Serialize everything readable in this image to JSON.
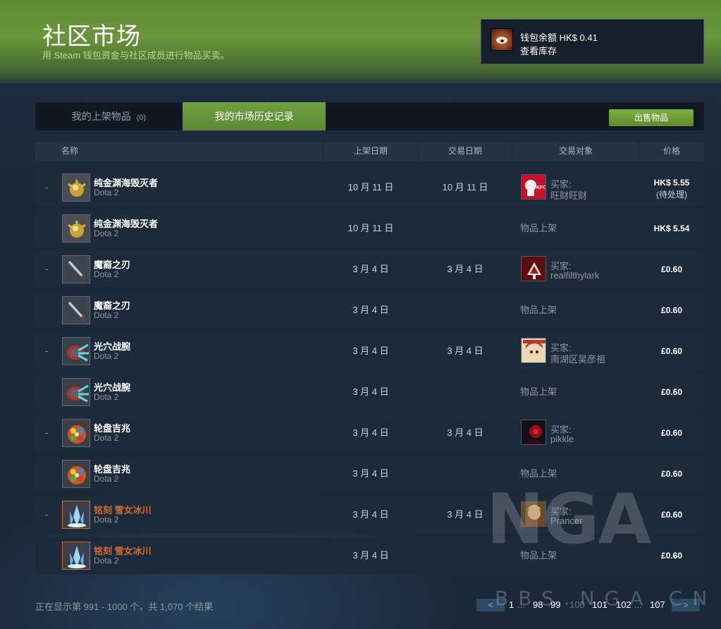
{
  "header": {
    "title": "社区市场",
    "subtitle": "用 Steam 钱包资金与社区成员进行物品买卖。"
  },
  "wallet": {
    "balance": "钱包余额 HK$ 0.41",
    "inventory_link": "查看库存"
  },
  "tabs": {
    "listings_label": "我的上架物品",
    "listings_count": "(0)",
    "history_label": "我的市场历史记录",
    "sell_button": "出售物品"
  },
  "table": {
    "headers": {
      "name": "名称",
      "listed_on": "上架日期",
      "acted_on": "交易日期",
      "party": "交易对象",
      "price": "价格"
    },
    "rows": [
      {
        "gain": "-",
        "name": "纯金渊海毁灭者",
        "game": "Dota 2",
        "listed_on": "10 月 11 日",
        "acted_on": "10 月 11 日",
        "party_label": "买家:",
        "party_name": "旺财旺财",
        "party_avatar": "kfc",
        "event": "",
        "price": "HK$ 5.55",
        "price_note": "(待处理)",
        "rarity_color": "#ffffff",
        "item_icon": "gold-orb"
      },
      {
        "gain": "",
        "name": "纯金渊海毁灭者",
        "game": "Dota 2",
        "listed_on": "10 月 11 日",
        "acted_on": "",
        "party_label": "",
        "party_name": "",
        "party_avatar": "",
        "event": "物品上架",
        "price": "HK$ 5.54",
        "price_note": "",
        "rarity_color": "#ffffff",
        "item_icon": "gold-orb"
      },
      {
        "gain": "-",
        "name": "魔裔之刃",
        "game": "Dota 2",
        "listed_on": "3 月 4 日",
        "acted_on": "3 月 4 日",
        "party_label": "买家:",
        "party_name": "realfilthylark",
        "party_avatar": "red-emblem",
        "event": "",
        "price": "£0.60",
        "price_note": "",
        "rarity_color": "#ffffff",
        "item_icon": "blade"
      },
      {
        "gain": "",
        "name": "魔裔之刃",
        "game": "Dota 2",
        "listed_on": "3 月 4 日",
        "acted_on": "",
        "party_label": "",
        "party_name": "",
        "party_avatar": "",
        "event": "物品上架",
        "price": "£0.60",
        "price_note": "",
        "rarity_color": "#ffffff",
        "item_icon": "blade"
      },
      {
        "gain": "-",
        "name": "光穴战腕",
        "game": "Dota 2",
        "listed_on": "3 月 4 日",
        "acted_on": "3 月 4 日",
        "party_label": "买家:",
        "party_name": "南湖区吴彦祖",
        "party_avatar": "anime",
        "event": "",
        "price": "£0.60",
        "price_note": "",
        "rarity_color": "#ffffff",
        "item_icon": "bracer"
      },
      {
        "gain": "",
        "name": "光穴战腕",
        "game": "Dota 2",
        "listed_on": "3 月 4 日",
        "acted_on": "",
        "party_label": "",
        "party_name": "",
        "party_avatar": "",
        "event": "物品上架",
        "price": "£0.60",
        "price_note": "",
        "rarity_color": "#ffffff",
        "item_icon": "bracer"
      },
      {
        "gain": "-",
        "name": "轮盘吉兆",
        "game": "Dota 2",
        "listed_on": "3 月 4 日",
        "acted_on": "3 月 4 日",
        "party_label": "买家:",
        "party_name": "pikkle",
        "party_avatar": "dark-red",
        "event": "",
        "price": "£0.60",
        "price_note": "",
        "rarity_color": "#ffffff",
        "item_icon": "wheel"
      },
      {
        "gain": "",
        "name": "轮盘吉兆",
        "game": "Dota 2",
        "listed_on": "3 月 4 日",
        "acted_on": "",
        "party_label": "",
        "party_name": "",
        "party_avatar": "",
        "event": "物品上架",
        "price": "£0.60",
        "price_note": "",
        "rarity_color": "#ffffff",
        "item_icon": "wheel"
      },
      {
        "gain": "-",
        "name": "铭刻 雪女冰川",
        "game": "Dota 2",
        "listed_on": "3 月 4 日",
        "acted_on": "3 月 4 日",
        "party_label": "买家:",
        "party_name": "Prancer",
        "party_avatar": "warrior",
        "event": "",
        "price": "£0.60",
        "price_note": "",
        "rarity_color": "#cf6a32",
        "item_icon": "ice-crystal"
      },
      {
        "gain": "",
        "name": "铭刻 雪女冰川",
        "game": "Dota 2",
        "listed_on": "3 月 4 日",
        "acted_on": "",
        "party_label": "",
        "party_name": "",
        "party_avatar": "",
        "event": "物品上架",
        "price": "£0.60",
        "price_note": "",
        "rarity_color": "#cf6a32",
        "item_icon": "ice-crystal"
      }
    ]
  },
  "footer": {
    "results_text": "正在显示第 991 - 1000 个，共 1,070 个结果"
  },
  "pager": {
    "prev": "<",
    "next": ">",
    "first": "1",
    "ellipsis_left": "...",
    "pages": [
      "98",
      "99",
      "100",
      "101",
      "102"
    ],
    "current": "100",
    "ellipsis_right": "...",
    "last": "107"
  },
  "watermark": {
    "logo": "NGA",
    "text": "BBS.NGA.CN"
  },
  "colors": {
    "accent_green": "#6fa13e",
    "link_blue": "#66c0f4",
    "background": "#1b2838",
    "immortal_orange": "#cf6a32"
  }
}
